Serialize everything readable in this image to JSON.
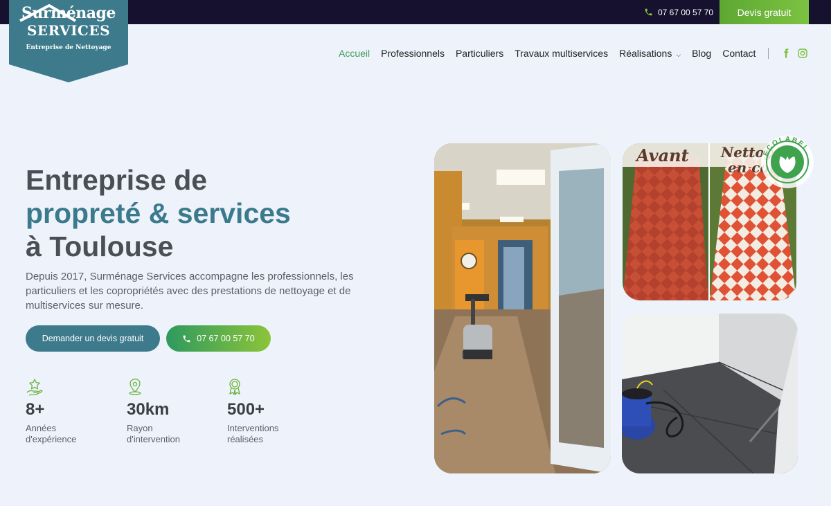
{
  "topbar": {
    "phone": "07 67 00 57 70",
    "cta_label": "Devis gratuit"
  },
  "logo": {
    "line1": "Surménage",
    "line2": "SERVICES",
    "line3": "Entreprise de Nettoyage"
  },
  "nav": {
    "items": [
      {
        "label": "Accueil",
        "active": true
      },
      {
        "label": "Professionnels"
      },
      {
        "label": "Particuliers"
      },
      {
        "label": "Travaux multiservices"
      },
      {
        "label": "Réalisations",
        "has_dropdown": true
      },
      {
        "label": "Blog"
      },
      {
        "label": "Contact"
      }
    ],
    "social": [
      "facebook-icon",
      "instagram-icon"
    ]
  },
  "hero": {
    "title_line1": "Entreprise de",
    "title_line2": "propreté & services",
    "title_line3": "à Toulouse",
    "description": "Depuis 2017, Surménage Services accompagne les professionnels, les particuliers et les copropriétés avec des prestations de nettoyage et de multiservices sur mesure.",
    "cta_devis": "Demander un devis gratuit",
    "cta_phone": "07 67 00 57 70"
  },
  "stats": [
    {
      "icon": "star-hand-icon",
      "value": "8+",
      "label_line1": "Années",
      "label_line2": "d'expérience"
    },
    {
      "icon": "location-pin-icon",
      "value": "30km",
      "label_line1": "Rayon",
      "label_line2": "d'intervention"
    },
    {
      "icon": "award-ribbon-icon",
      "value": "500+",
      "label_line1": "Interventions",
      "label_line2": "réalisées"
    }
  ],
  "photos": {
    "before_label": "Avant",
    "after_label": "Nettoyage en cours",
    "badge_text": "ECOLABEL"
  },
  "colors": {
    "topbar_bg": "#15112e",
    "accent_green": "#7cc242",
    "brand_teal": "#3d7a8b",
    "page_bg": "#eef3fb"
  }
}
